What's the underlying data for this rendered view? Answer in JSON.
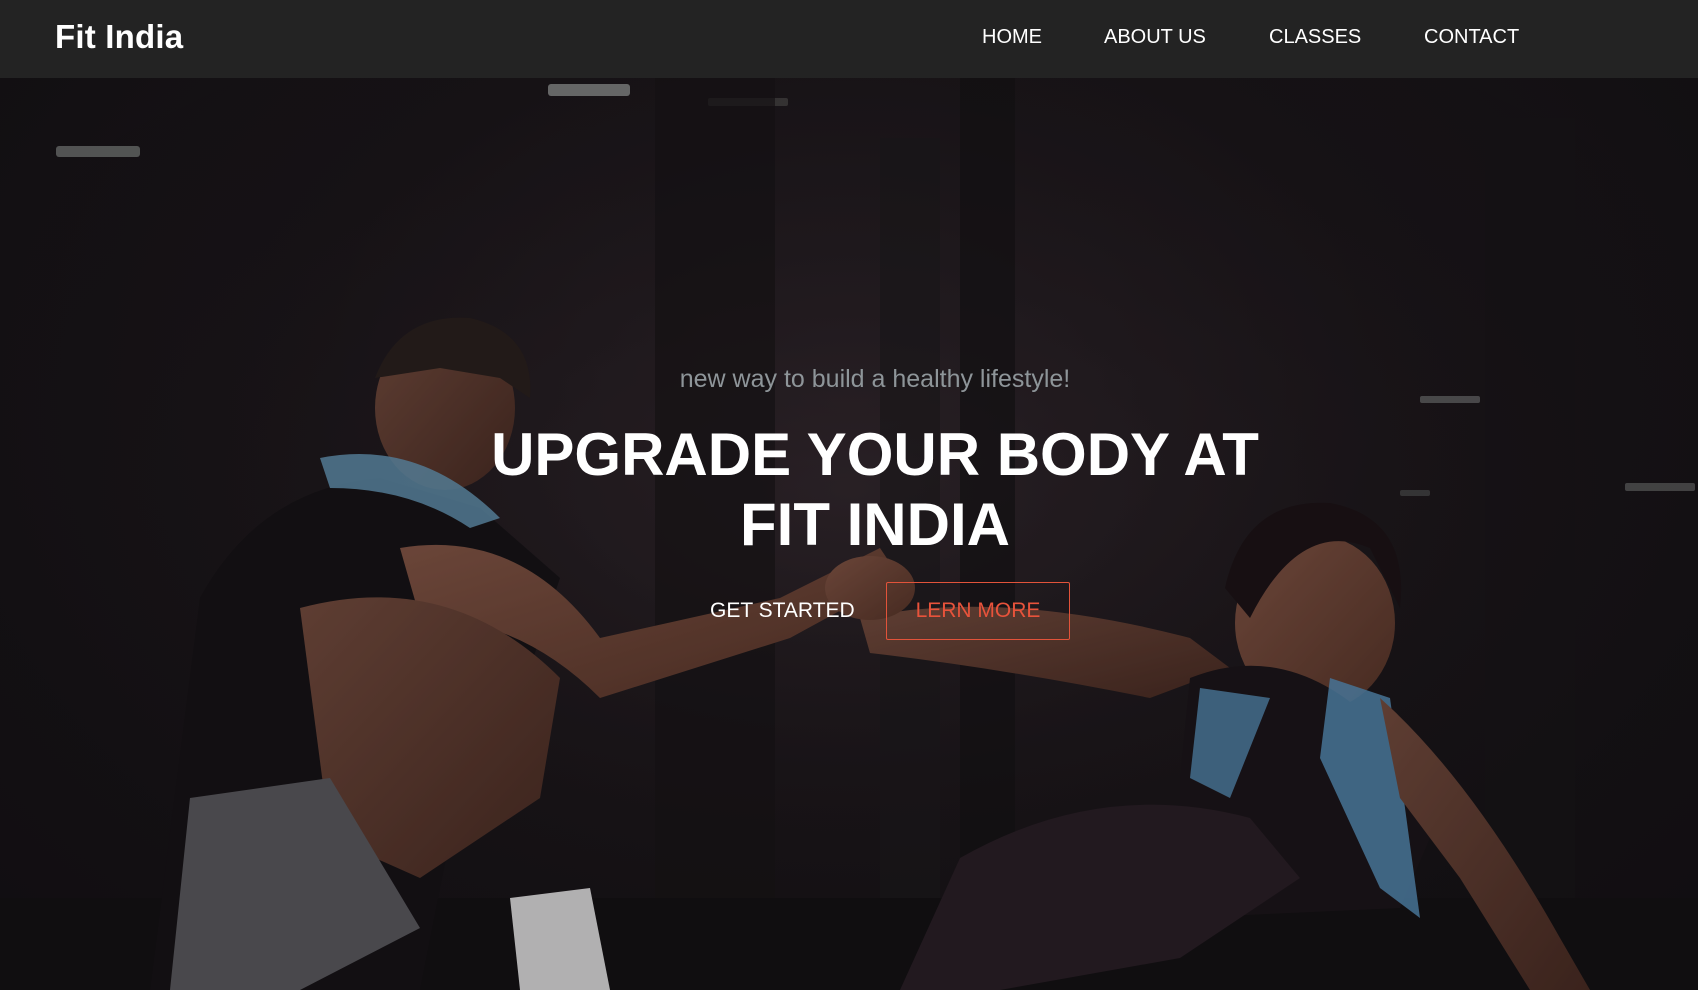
{
  "navbar": {
    "brand": "Fit India",
    "links": [
      {
        "label": "HOME"
      },
      {
        "label": "ABOUT US"
      },
      {
        "label": "CLASSES"
      },
      {
        "label": "CONTACT"
      }
    ]
  },
  "hero": {
    "tagline": "new way to build a healthy lifestyle!",
    "headline_line1": "UPGRADE YOUR BODY AT",
    "headline_line2": "FIT INDIA",
    "primary_button": "GET STARTED",
    "secondary_button": "LERN MORE"
  },
  "colors": {
    "navbar_bg": "#232323",
    "accent": "#e8533b",
    "tagline": "#8e9599",
    "text": "#ffffff"
  }
}
